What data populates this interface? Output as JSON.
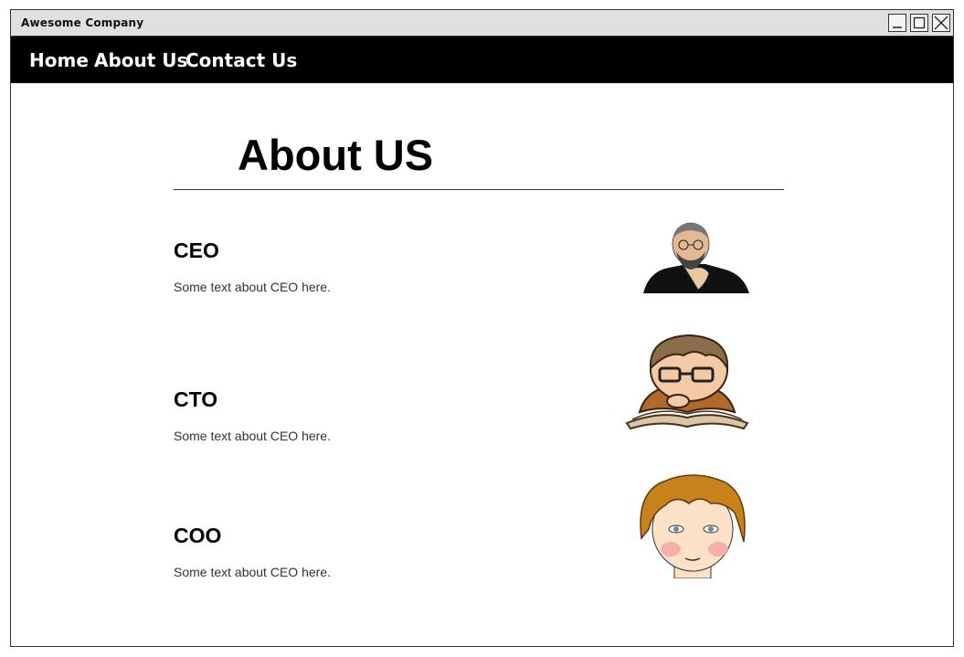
{
  "window": {
    "title": "Awesome Company",
    "controls": [
      "minimize",
      "maximize",
      "close"
    ]
  },
  "nav": {
    "items": [
      {
        "label": "Home"
      },
      {
        "label": "About Us"
      },
      {
        "label": "Contact Us"
      }
    ]
  },
  "page": {
    "heading": "About US"
  },
  "team": [
    {
      "role": "CEO",
      "description": "Some text about CEO here.",
      "image": "ceo-portrait"
    },
    {
      "role": "CTO",
      "description": "Some text about CEO here.",
      "image": "cto-portrait"
    },
    {
      "role": "COO",
      "description": "Some text about CEO here.",
      "image": "coo-portrait"
    }
  ]
}
